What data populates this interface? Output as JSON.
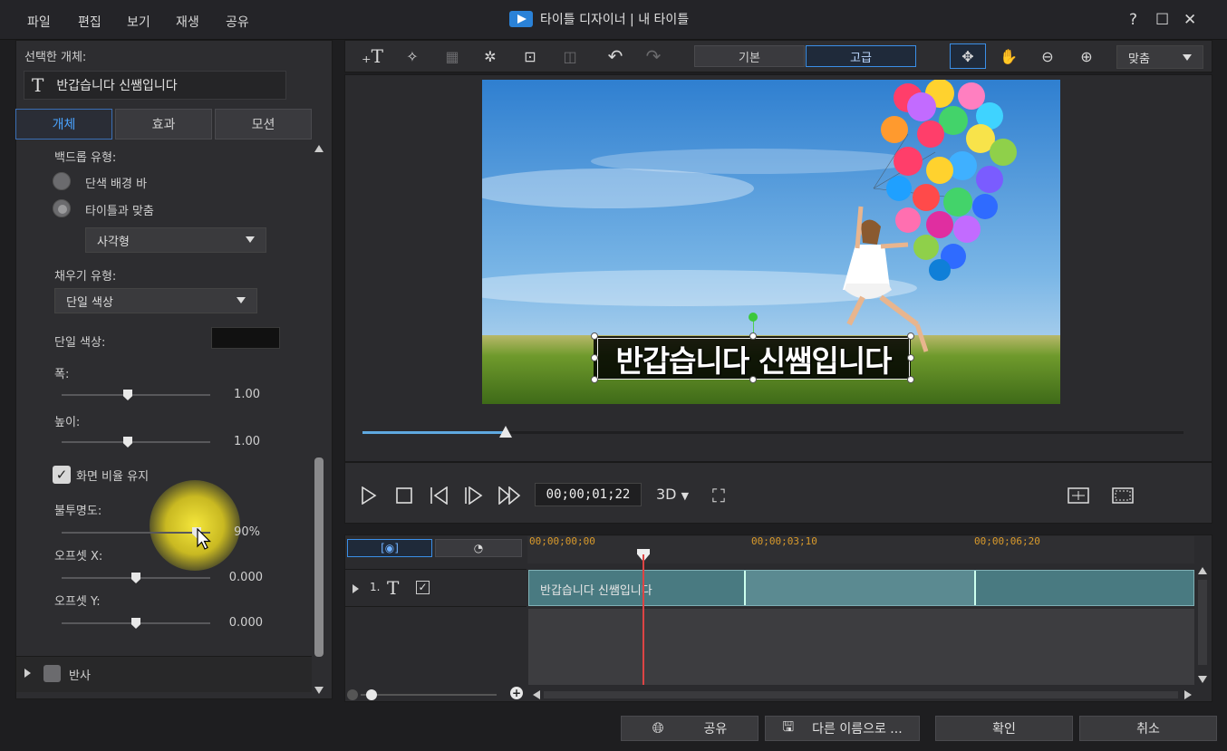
{
  "window": {
    "title": "타이틀 디자이너  |  내 타이틀",
    "help": "?",
    "maximize": "☐",
    "close": "✕"
  },
  "menu": [
    "파일",
    "편집",
    "보기",
    "재생",
    "공유"
  ],
  "left": {
    "selected_label": "선택한 개체:",
    "selected_icon": "T",
    "selected_name": "반갑습니다 신쌤입니다",
    "tabs": [
      "개체",
      "효과",
      "모션"
    ],
    "backdrop_type_label": "백드롭 유형:",
    "radio_solid_bar": "단색 배경 바",
    "radio_fit_title": "타이틀과 맞춤",
    "shape_select": "사각형",
    "fill_type_label": "채우기 유형:",
    "fill_select": "단일 색상",
    "single_color_label": "단일 색상:",
    "single_color_value": "#111111",
    "width_label": "폭:",
    "width_value": "1.00",
    "height_label": "높이:",
    "height_value": "1.00",
    "keep_ratio_label": "화면 비율 유지",
    "opacity_label": "불투명도:",
    "opacity_value": "90%",
    "offset_x_label": "오프셋 X:",
    "offset_x_value": "0.000",
    "offset_y_label": "오프셋 Y:",
    "offset_y_value": "0.000",
    "reflection_label": "반사"
  },
  "toolbar": {
    "mode_basic": "기본",
    "mode_advanced": "고급",
    "zoom_select": "맞춤"
  },
  "preview": {
    "title_text": "반갑습니다 신쌤입니다"
  },
  "playback": {
    "timecode": "00;00;01;22",
    "mode_3d": "3D"
  },
  "timeline": {
    "ruler": [
      "00;00;00;00",
      "00;00;03;10",
      "00;00;06;20"
    ],
    "track_number": "1.",
    "track_icon": "T",
    "clip_label": "반갑습니다 신쌤입니다"
  },
  "buttons": {
    "share": "공유",
    "save_as": "다른 이름으로 ...",
    "ok": "확인",
    "cancel": "취소"
  }
}
